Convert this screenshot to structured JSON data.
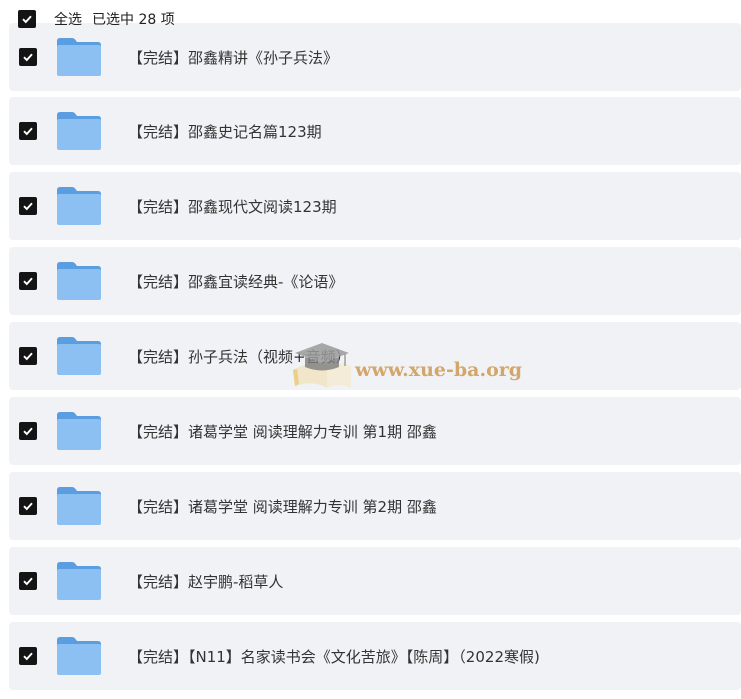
{
  "header": {
    "select_all_label": "全选",
    "selected_count_text": "已选中  28  项"
  },
  "files": [
    {
      "name": "【完结】邵鑫精讲《孙子兵法》",
      "checked": true,
      "icon": "folder-icon"
    },
    {
      "name": "【完结】邵鑫史记名篇123期",
      "checked": true,
      "icon": "folder-icon"
    },
    {
      "name": "【完结】邵鑫现代文阅读123期",
      "checked": true,
      "icon": "folder-icon"
    },
    {
      "name": "【完结】邵鑫宜读经典-《论语》",
      "checked": true,
      "icon": "folder-icon"
    },
    {
      "name": "【完结】孙子兵法（视频+音频）",
      "checked": true,
      "icon": "folder-icon"
    },
    {
      "name": "【完结】诸葛学堂 阅读理解力专训 第1期 邵鑫",
      "checked": true,
      "icon": "folder-icon"
    },
    {
      "name": "【完结】诸葛学堂 阅读理解力专训 第2期 邵鑫",
      "checked": true,
      "icon": "folder-icon"
    },
    {
      "name": "【完结】赵宇鹏-稻草人",
      "checked": true,
      "icon": "folder-icon"
    },
    {
      "name": "【完结】【N11】名家读书会《文化苦旅》【陈周】（2022寒假)",
      "checked": true,
      "icon": "folder-icon"
    }
  ],
  "watermark": {
    "text": "www.xue-ba.org",
    "icon": "graduation-cap-icon"
  },
  "colors": {
    "row_background": "#f1f2f5",
    "checkbox_fill": "#141414",
    "folder_blue": "#7fb6ee"
  }
}
